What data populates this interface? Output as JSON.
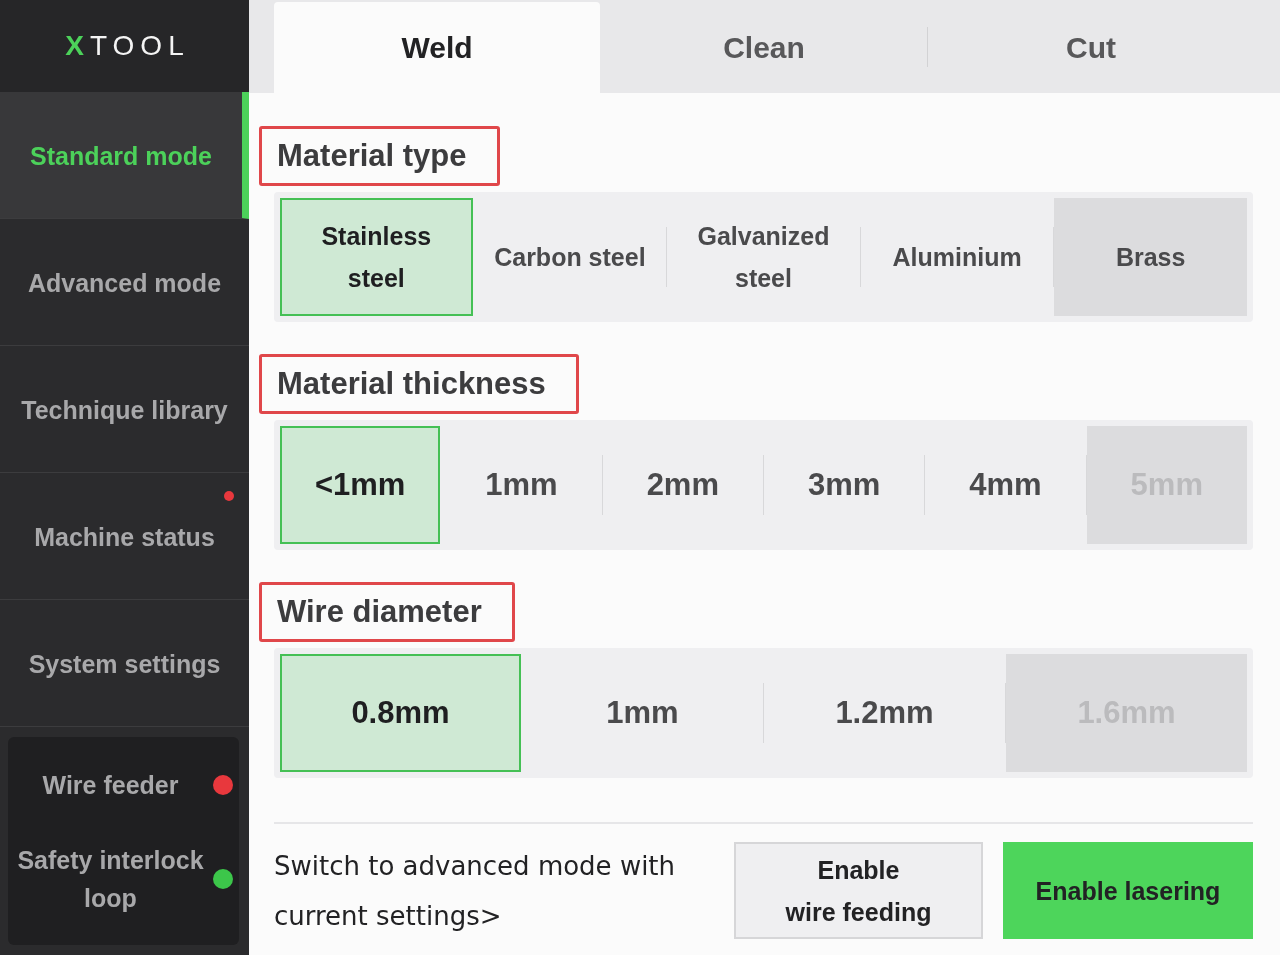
{
  "sidebar": {
    "logo": "XTOOL",
    "nav": [
      {
        "label": "Standard mode",
        "selected": true,
        "alert": false
      },
      {
        "label": "Advanced mode",
        "selected": false,
        "alert": false
      },
      {
        "label": "Technique library",
        "selected": false,
        "alert": false
      },
      {
        "label": "Machine status",
        "selected": false,
        "alert": true
      },
      {
        "label": "System settings",
        "selected": false,
        "alert": false
      }
    ],
    "status": [
      {
        "label": "Wire feeder",
        "color": "#e8383d"
      },
      {
        "label": "Safety interlock loop",
        "color": "#3cc64a"
      }
    ]
  },
  "tabs": [
    {
      "label": "Weld",
      "selected": true
    },
    {
      "label": "Clean",
      "selected": false
    },
    {
      "label": "Cut",
      "selected": false
    }
  ],
  "sections": [
    {
      "title": "Material type",
      "highlighted": true,
      "options": [
        {
          "label": "Stainless\nsteel",
          "selected": true,
          "highlighted": false,
          "disabled": false
        },
        {
          "label": "Carbon steel",
          "selected": false,
          "highlighted": false,
          "disabled": false
        },
        {
          "label": "Galvanized\nsteel",
          "selected": false,
          "highlighted": false,
          "disabled": false
        },
        {
          "label": "Aluminium",
          "selected": false,
          "highlighted": false,
          "disabled": false
        },
        {
          "label": "Brass",
          "selected": false,
          "highlighted": true,
          "disabled": false
        }
      ]
    },
    {
      "title": "Material thickness",
      "highlighted": true,
      "options": [
        {
          "label": "<1mm",
          "selected": true,
          "highlighted": false,
          "disabled": false
        },
        {
          "label": "1mm",
          "selected": false,
          "highlighted": false,
          "disabled": false
        },
        {
          "label": "2mm",
          "selected": false,
          "highlighted": false,
          "disabled": false
        },
        {
          "label": "3mm",
          "selected": false,
          "highlighted": false,
          "disabled": false
        },
        {
          "label": "4mm",
          "selected": false,
          "highlighted": false,
          "disabled": false
        },
        {
          "label": "5mm",
          "selected": false,
          "highlighted": false,
          "disabled": true
        }
      ]
    },
    {
      "title": "Wire diameter",
      "highlighted": true,
      "options": [
        {
          "label": "0.8mm",
          "selected": true,
          "highlighted": false,
          "disabled": false
        },
        {
          "label": "1mm",
          "selected": false,
          "highlighted": false,
          "disabled": false
        },
        {
          "label": "1.2mm",
          "selected": false,
          "highlighted": false,
          "disabled": false
        },
        {
          "label": "1.6mm",
          "selected": false,
          "highlighted": false,
          "disabled": true
        }
      ]
    }
  ],
  "footer": {
    "link": "Switch to advanced mode with current settings>",
    "buttons": [
      {
        "label": "Enable\nwire feeding",
        "kind": "secondary"
      },
      {
        "label": "Enable lasering",
        "kind": "primary"
      }
    ]
  }
}
